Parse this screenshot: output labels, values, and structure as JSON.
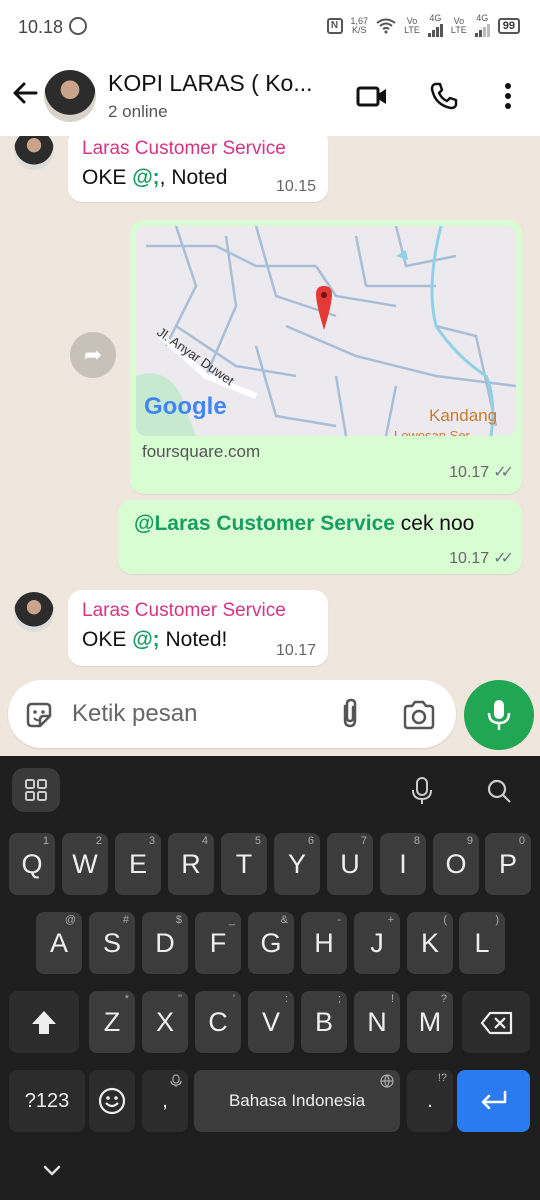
{
  "status": {
    "time": "10.18",
    "speed_value": "1,67",
    "speed_unit": "K/S",
    "net1": "4G",
    "vo1": "Vo",
    "lte1": "LTE",
    "net2": "4G",
    "vo2": "Vo",
    "lte2": "LTE",
    "battery": "99"
  },
  "header": {
    "title": "KOPI LARAS ( Ko...",
    "subtitle": "2 online"
  },
  "messages": [
    {
      "sender": "Laras Customer Service",
      "mention": "@;",
      "text": ", Noted",
      "time": "10.15"
    },
    {
      "link": "foursquare.com",
      "map_road": "Jl. Anyar Duwet",
      "map_logo": "Google",
      "map_place": "Kandang",
      "map_place2": "Lowosan Ser",
      "time": "10.17"
    },
    {
      "mention": "@Laras Customer Service",
      "text": " cek noo",
      "time": "10.17"
    },
    {
      "sender": "Laras Customer Service",
      "mention": "@;",
      "text": " Noted!",
      "prefix": "OKE ",
      "time": "10.17"
    }
  ],
  "first_prefix": "OKE ",
  "input": {
    "placeholder": "Ketik pesan"
  },
  "keyboard": {
    "row1": [
      [
        "Q",
        "1"
      ],
      [
        "W",
        "2"
      ],
      [
        "E",
        "3"
      ],
      [
        "R",
        "4"
      ],
      [
        "T",
        "5"
      ],
      [
        "Y",
        "6"
      ],
      [
        "U",
        "7"
      ],
      [
        "I",
        "8"
      ],
      [
        "O",
        "9"
      ],
      [
        "P",
        "0"
      ]
    ],
    "row2": [
      [
        "A",
        "@"
      ],
      [
        "S",
        "#"
      ],
      [
        "D",
        "$"
      ],
      [
        "F",
        "_"
      ],
      [
        "G",
        "&"
      ],
      [
        "H",
        "-"
      ],
      [
        "J",
        "+"
      ],
      [
        "K",
        "("
      ],
      [
        "L",
        ")"
      ]
    ],
    "row3": [
      [
        "Z",
        "*"
      ],
      [
        "X",
        "\""
      ],
      [
        "C",
        "'"
      ],
      [
        "V",
        ":"
      ],
      [
        "B",
        ";"
      ],
      [
        "N",
        "!"
      ],
      [
        "M",
        "?"
      ]
    ],
    "symbols": "?123",
    "comma": ",",
    "space": "Bahasa Indonesia",
    "period": ".",
    "period_hint": "!?"
  }
}
